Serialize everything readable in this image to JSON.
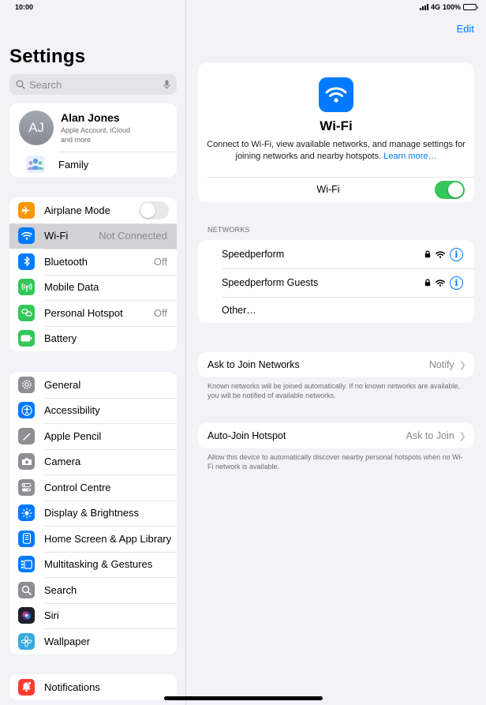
{
  "status": {
    "time": "10:00",
    "network": "4G",
    "battery": "100%"
  },
  "sidebar": {
    "title": "Settings",
    "search_placeholder": "Search",
    "profile": {
      "initials": "AJ",
      "name": "Alan Jones",
      "sub1": "Apple Account, iCloud",
      "sub2": "and more",
      "family": "Family"
    },
    "connectivity": [
      {
        "label": "Airplane Mode",
        "value": "",
        "icon": "airplane-icon",
        "color": "#ff9500"
      },
      {
        "label": "Wi-Fi",
        "value": "Not Connected",
        "icon": "wifi-icon",
        "color": "#007aff"
      },
      {
        "label": "Bluetooth",
        "value": "Off",
        "icon": "bluetooth-icon",
        "color": "#007aff"
      },
      {
        "label": "Mobile Data",
        "value": "",
        "icon": "antenna-icon",
        "color": "#34c759"
      },
      {
        "label": "Personal Hotspot",
        "value": "Off",
        "icon": "hotspot-icon",
        "color": "#34c759"
      },
      {
        "label": "Battery",
        "value": "",
        "icon": "battery-icon",
        "color": "#34c759"
      }
    ],
    "general": [
      {
        "label": "General",
        "icon": "gear-icon",
        "color": "#8e8e93"
      },
      {
        "label": "Accessibility",
        "icon": "accessibility-icon",
        "color": "#007aff"
      },
      {
        "label": "Apple Pencil",
        "icon": "pencil-icon",
        "color": "#8e8e93"
      },
      {
        "label": "Camera",
        "icon": "camera-icon",
        "color": "#8e8e93"
      },
      {
        "label": "Control Centre",
        "icon": "control-centre-icon",
        "color": "#8e8e93"
      },
      {
        "label": "Display & Brightness",
        "icon": "sun-icon",
        "color": "#007aff"
      },
      {
        "label": "Home Screen & App Library",
        "icon": "home-screen-icon",
        "color": "#007aff"
      },
      {
        "label": "Multitasking & Gestures",
        "icon": "multitasking-icon",
        "color": "#007aff"
      },
      {
        "label": "Search",
        "icon": "search-icon",
        "color": "#8e8e93"
      },
      {
        "label": "Siri",
        "icon": "siri-icon",
        "color": "#333340"
      },
      {
        "label": "Wallpaper",
        "icon": "flower-icon",
        "color": "#35aadc"
      }
    ],
    "notifications": {
      "label": "Notifications",
      "icon": "bell-icon",
      "color": "#ff3b30"
    }
  },
  "detail": {
    "edit": "Edit",
    "title": "Wi-Fi",
    "description": "Connect to Wi-Fi, view available networks, and manage settings for joining networks and nearby hotspots.",
    "learn_more": "Learn more…",
    "wifi_label": "Wi-Fi",
    "networks_header": "NETWORKS",
    "networks": [
      {
        "name": "Speedperform"
      },
      {
        "name": "Speedperform Guests"
      }
    ],
    "other": "Other…",
    "ask_to_join": {
      "label": "Ask to Join Networks",
      "value": "Notify",
      "note": "Known networks will be joined automatically. If no known networks are available, you will be notified of available networks."
    },
    "auto_join": {
      "label": "Auto-Join Hotspot",
      "value": "Ask to Join",
      "note": "Allow this device to automatically discover nearby personal hotspots when no Wi-Fi network is available."
    }
  }
}
